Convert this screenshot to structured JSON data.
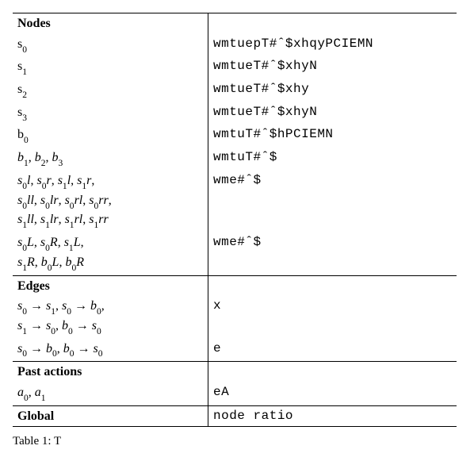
{
  "sections": {
    "nodes": "Nodes",
    "edges": "Edges",
    "past": "Past actions",
    "global": "Global"
  },
  "rows": {
    "n0_l": "s",
    "n0_ls": "0",
    "n0_r": "wmtuepT#ˆ$xhqyPCIEMN",
    "n1_l": "s",
    "n1_ls": "1",
    "n1_r": "wmtueT#ˆ$xhyN",
    "n2_l": "s",
    "n2_ls": "2",
    "n2_r": "wmtueT#ˆ$xhy",
    "n3_l": "s",
    "n3_ls": "3",
    "n3_r": "wmtueT#ˆ$xhyN",
    "n4_l": "b",
    "n4_ls": "0",
    "n4_r": "wmtuT#ˆ$hPCIEMN",
    "n5_r": "wmtuT#ˆ$",
    "n6_r": "wme#ˆ$",
    "n7_r": "wme#ˆ$",
    "e0_r": "x",
    "e1_r": "e",
    "p0_r": "eA",
    "g0_r": "node ratio"
  },
  "caption_prefix": "Table 1: ",
  "caption_rest": "T"
}
